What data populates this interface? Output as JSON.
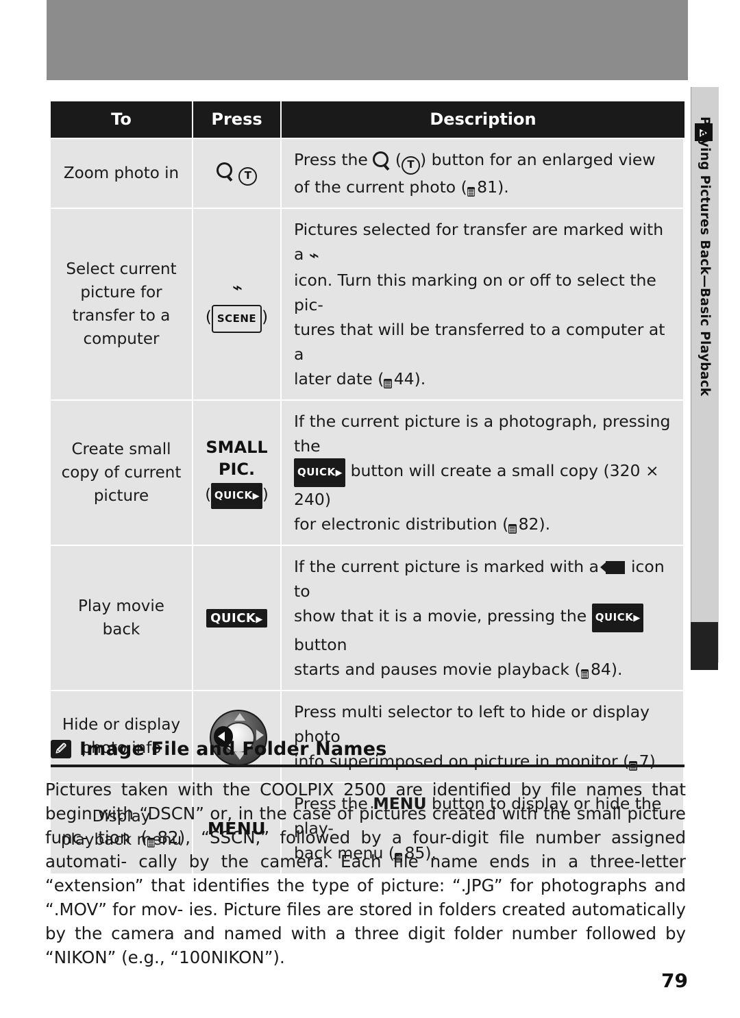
{
  "page": {
    "number": "79",
    "side_tab_label": "Playing Pictures Back—Basic Playback",
    "side_tab_icon": "playback-icon"
  },
  "table": {
    "headers": [
      "To",
      "Press",
      "Description"
    ],
    "rows": [
      {
        "to": "Zoom photo in",
        "press_icon": "zoom-magnifier-t-button",
        "press_text": "(T)",
        "desc_parts": [
          "Press the ",
          " (",
          "T",
          ") button for an enlarged view of the current photo (",
          "81",
          ")."
        ],
        "desc_plain": "Press the [zoom] (T) button for an enlarged view of the current photo (book 81).",
        "ref_page": "81"
      },
      {
        "to": "Select current picture for transfer to a computer",
        "press_icon": "transfer-mark-scene-button",
        "press_text": "(SCENE)",
        "desc_plain": "Pictures selected for transfer are marked with a [transfer] icon.  Turn this marking on or off to select the pictures that will be transferred to a computer at a later date (book 44).",
        "ref_page": "44"
      },
      {
        "to": "Create small copy of current picture",
        "press_text": "SMALL PIC.",
        "press_sub": "(QUICK▶)",
        "desc_plain": "If the current picture is a photograph, pressing the QUICK▶ button will create a small copy (320 × 240) for electronic distribution (book 82).",
        "ref_page": "82",
        "copy_size": "320 × 240"
      },
      {
        "to": "Play movie back",
        "press_text": "QUICK▶",
        "desc_plain": "If the current picture is marked with a [movie] icon to show that it is a movie, pressing the QUICK▶ button starts and pauses movie playback (book 84).",
        "ref_page": "84"
      },
      {
        "to": "Hide or display photo info",
        "press_icon": "multi-selector-dial",
        "desc_plain": "Press multi selector to left to hide or display photo info superimposed on picture in monitor (book 7).",
        "ref_page": "7"
      },
      {
        "to": "Display playback menu",
        "press_text": "MENU",
        "desc_plain": "Press the MENU button to display or hide the playback menu (book 85).",
        "ref_page": "85"
      }
    ]
  },
  "section": {
    "icon": "note-icon",
    "title": "Image File and Folder Names",
    "body": "Pictures taken with the COOLPIX 2500 are identified by file names that begin with “DSCN” or, in the case of pictures created with the small picture function (  82), “SSCN,” followed by a four-digit file number assigned automatically by the camera.  Each file name ends in a three-letter “extension” that identifies the type of picture: “.JPG” for photographs and “.MOV” for movies.  Picture files are stored in folders created automatically by the camera and named with a three digit folder number followed by “NIKON” (e.g., “100NIKON”)."
  }
}
